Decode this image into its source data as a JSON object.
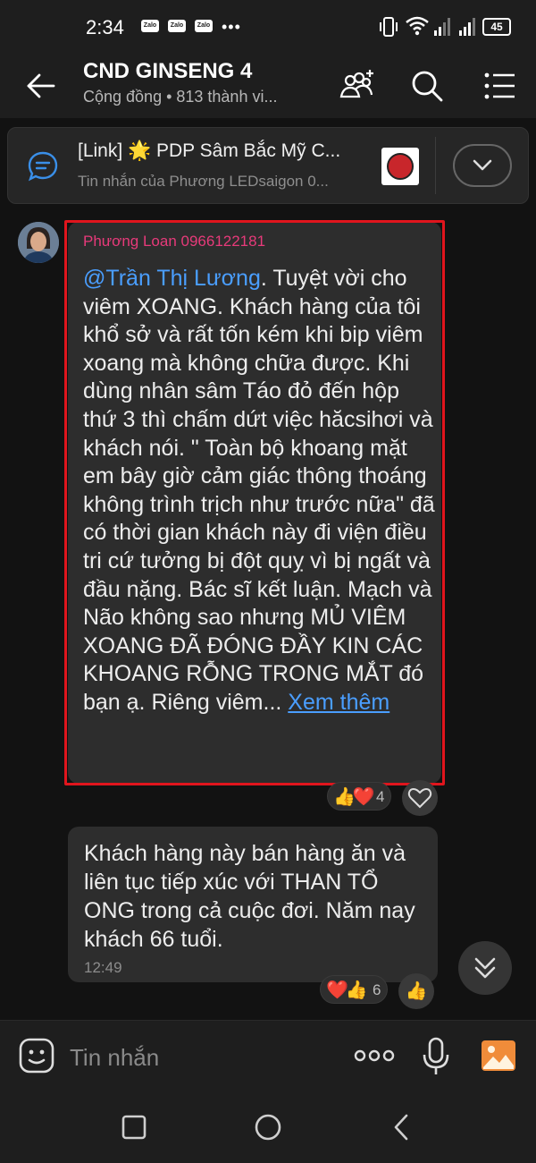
{
  "status_bar": {
    "time": "2:34",
    "app_icon_label": "Zalo",
    "battery": "45"
  },
  "header": {
    "title": "CND GINSENG 4",
    "subtitle": "Cộng đồng • 813 thành vi..."
  },
  "pinned": {
    "title": "[Link] 🌟 PDP Sâm Bắc Mỹ C...",
    "subtitle": "Tin nhắn của Phương LEDsaigon 0..."
  },
  "messages": [
    {
      "sender": "Phương Loan 0966122181",
      "mention": "@Trần Thị Lương",
      "text": ". Tuyệt vời cho viêm XOANG. Khách hàng của tôi khổ sở và rất tốn kém khi bip viêm xoang mà không chữa được. Khi dùng nhân sâm Táo đỏ đến hộp thứ 3 thì chấm dứt việc hăcsihơi và khách nói. \" Toàn bộ khoang mặt em bây giờ cảm giác thông thoáng không trình trịch như trước nữa\" đã có thời gian khách này đi viện điều tri cứ tưởng bị đột quỵ vì bị ngất và đầu nặng. Bác sĩ kết luận. Mạch và Não không sao nhưng MỦ VIÊM XOANG ĐÃ ĐÓNG ĐẦY KIN CÁC KHOANG RỖNG TRONG MẮT đó bạn ạ. Riêng viêm...",
      "see_more": "Xem thêm",
      "reactions": "👍❤️",
      "reaction_count": "4"
    },
    {
      "text": "Khách hàng này bán hàng ăn và liên tục tiếp xúc với THAN TỔ ONG trong cả cuộc đơi. Năm nay khách 66 tuổi.",
      "time": "12:49",
      "reactions": "❤️👍",
      "reaction_count": "6",
      "quick_reaction": "👍"
    }
  ],
  "input": {
    "placeholder": "Tin nhắn"
  },
  "colors": {
    "mention": "#4a9eff",
    "sender": "#e73a7a",
    "highlight_border": "#e0151d"
  }
}
